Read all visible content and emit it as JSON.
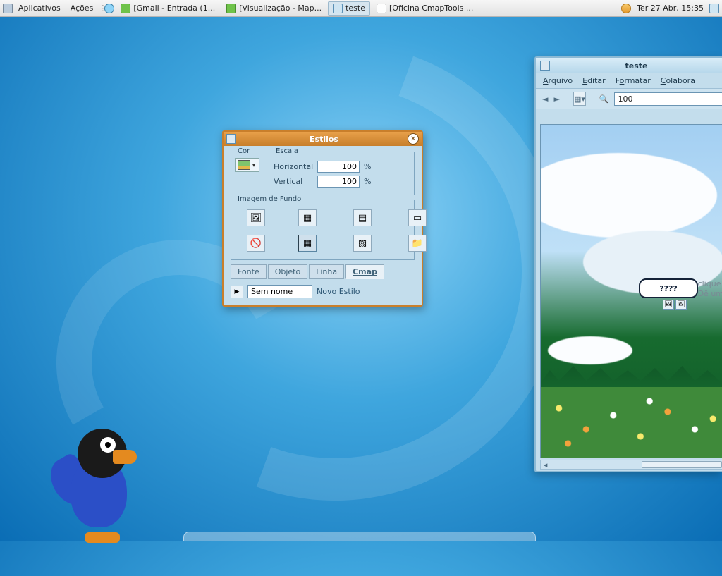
{
  "panel": {
    "menu_apps": "Aplicativos",
    "menu_actions": "Ações",
    "tasks": [
      {
        "label": "[Gmail - Entrada (1...",
        "iconClass": "tb-green"
      },
      {
        "label": "[Visualização - Map...",
        "iconClass": "tb-green"
      },
      {
        "label": "teste",
        "iconClass": "tb-cmap",
        "active": true
      },
      {
        "label": "[Oficina CmapTools ...",
        "iconClass": "tb-doc"
      }
    ],
    "clock": "Ter 27 Abr, 15:35"
  },
  "estilos_dialog": {
    "title": "Estilos",
    "groups": {
      "cor_legend": "Cor",
      "escala_legend": "Escala",
      "horizontal_label": "Horizontal",
      "horizontal_value": "100",
      "horizontal_unit": "%",
      "vertical_label": "Vertical",
      "vertical_value": "100",
      "vertical_unit": "%",
      "fundo_legend": "Imagem de Fundo"
    },
    "tabs": {
      "fonte": "Fonte",
      "objeto": "Objeto",
      "linha": "Linha",
      "cmap": "Cmap"
    },
    "style_name_value": "Sem nome",
    "novo_estilo": "Novo Estilo"
  },
  "teste_window": {
    "title": "teste",
    "menubar": {
      "arquivo": "Arquivo",
      "editar": "Editar",
      "formatar": "Formatar",
      "colaborar": "Colabora"
    },
    "zoom_value": "100",
    "node_text": "????",
    "hint_line1": "clique",
    "hint_line2": "Dê um"
  }
}
